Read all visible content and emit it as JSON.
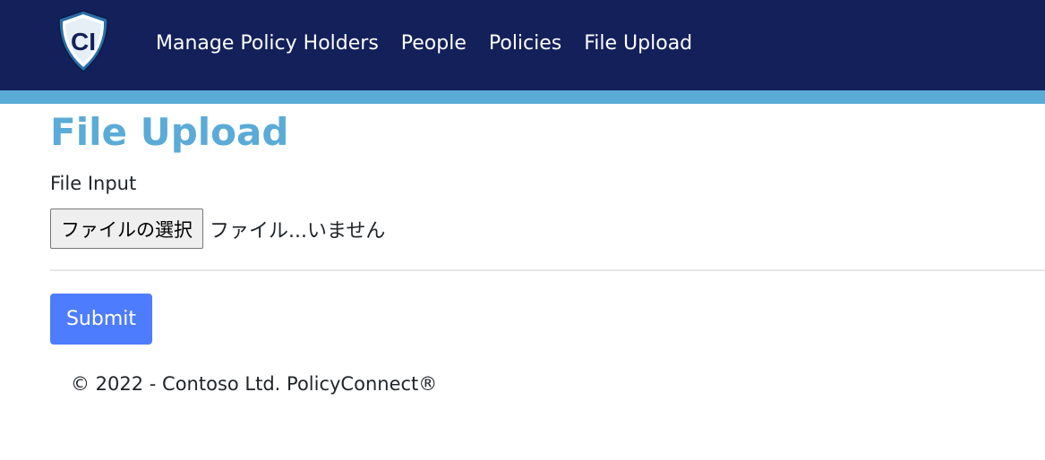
{
  "navbar": {
    "logo": {
      "text": "CI",
      "icon": "shield-logo-icon"
    },
    "links": [
      {
        "label": "Manage Policy Holders"
      },
      {
        "label": "People"
      },
      {
        "label": "Policies"
      },
      {
        "label": "File Upload"
      }
    ]
  },
  "main": {
    "title": "File Upload",
    "file_input": {
      "label": "File Input",
      "button_label": "ファイルの選択",
      "status": "ファイル...いません"
    },
    "submit_label": "Submit"
  },
  "footer": {
    "text": "© 2022 - Contoso Ltd. PolicyConnect®"
  },
  "colors": {
    "navbar": "#13205a",
    "accent": "#5aabd7",
    "primary_button": "#4e7cff"
  }
}
